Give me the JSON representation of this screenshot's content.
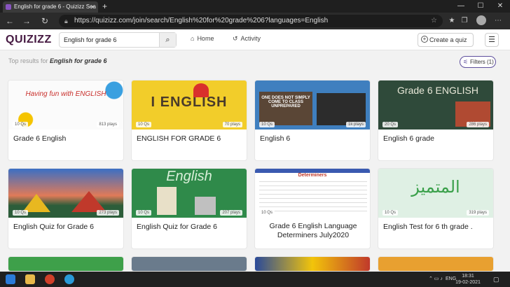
{
  "browser": {
    "tab_title": "English for grade 6 - Quizizz Sea",
    "tab_close": "✕",
    "new_tab": "+",
    "url": "https://quizizz.com/join/search/English%20for%20grade%206?languages=English",
    "window_controls": [
      "—",
      "☐",
      "✕"
    ]
  },
  "header": {
    "logo": "QUIZIZZ",
    "search_value": "English for grade 6",
    "nav": [
      {
        "label": "Home",
        "icon": "home-icon"
      },
      {
        "label": "Activity",
        "icon": "history-icon"
      }
    ],
    "create_label": "Create a quiz"
  },
  "results": {
    "prefix": "Top results for",
    "query": "English for grade 6",
    "filters_label": "Filters (1)"
  },
  "cards": [
    {
      "title": "Grade 6 English",
      "qs": "10 Qs",
      "plays": "813 plays",
      "thumb_text": "Having fun with ENGLISH"
    },
    {
      "title": "ENGLISH FOR GRADE 6",
      "qs": "10 Qs",
      "plays": "70 plays",
      "thumb_text": "I ENGLISH"
    },
    {
      "title": "English 6",
      "qs": "10 Qs",
      "plays": "1k plays",
      "thumb_text": "ONE DOES NOT SIMPLY COME TO CLASS UNPREPARED"
    },
    {
      "title": "English 6 grade",
      "qs": "20 Qs",
      "plays": "286 plays",
      "thumb_text": "Grade 6 ENGLISH"
    },
    {
      "title": "English Quiz for Grade 6",
      "qs": "10 Qs",
      "plays": "273 plays",
      "thumb_text": ""
    },
    {
      "title": "English Quiz for Grade 6",
      "qs": "10 Qs",
      "plays": "207 plays",
      "thumb_text": "English"
    },
    {
      "title": "Grade 6 English Language Determiners July2020",
      "qs": "10 Qs",
      "plays": "",
      "thumb_text": "Determiners"
    },
    {
      "title": "English Test for 6 th grade .",
      "qs": "10 Qs",
      "plays": "319 plays",
      "thumb_text": "المتميز"
    }
  ],
  "taskbar": {
    "lang": "ENG",
    "time": "18:31",
    "date": "19-02-2021"
  },
  "colors": {
    "brand": "#461a42",
    "accent": "#5d4e9c"
  }
}
